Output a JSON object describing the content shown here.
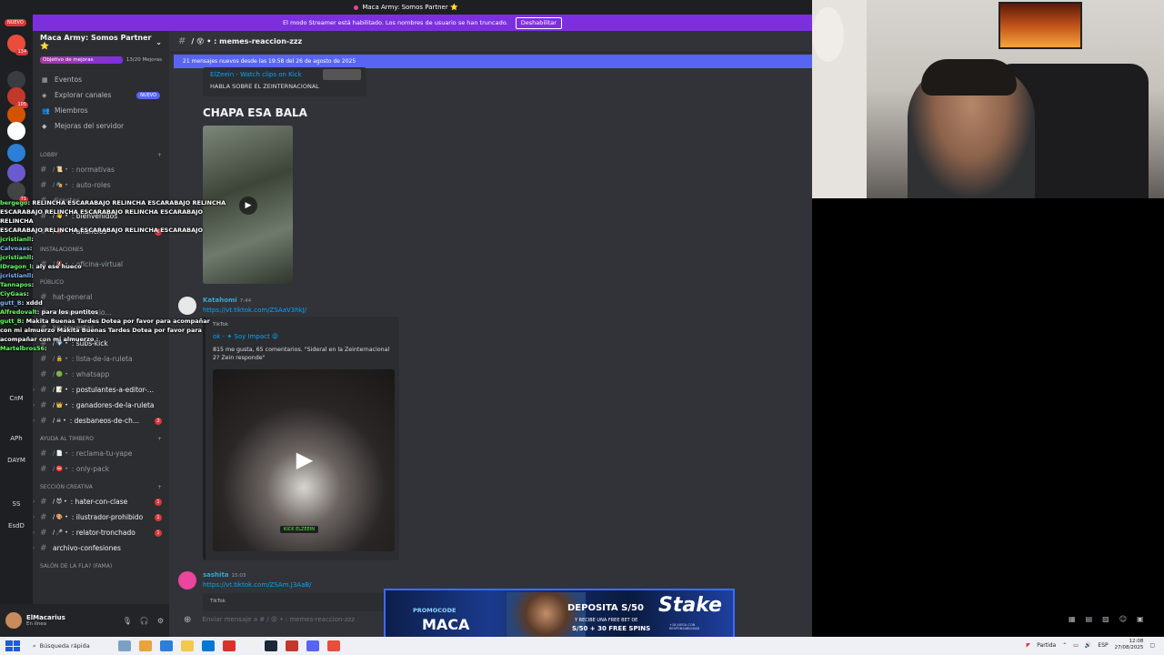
{
  "window": {
    "title": "Maca Army: Somos Partner ⭐"
  },
  "streamer_banner": {
    "text": "El modo Streamer está habilitado. Los nombres de usuario se han truncado.",
    "button": "Deshabilitar"
  },
  "rail": {
    "new_label": "NUEVO",
    "items": [
      {
        "badge": "134",
        "color": "#e84e3b"
      },
      {
        "badge": "",
        "color": "#3a3c43"
      },
      {
        "badge": "105",
        "color": "#c0392b"
      },
      {
        "badge": "",
        "color": "#d35400"
      },
      {
        "badge": "",
        "color": "#ffffff"
      },
      {
        "badge": "",
        "color": "#2d7ed6"
      },
      {
        "badge": "",
        "color": "#6a5acd"
      },
      {
        "badge": "71",
        "color": "#444444"
      }
    ],
    "texts": [
      {
        "label": "CnM",
        "badge": ""
      },
      {
        "label": "APh",
        "badge": ""
      },
      {
        "label": "DAYM",
        "badge": "8"
      },
      {
        "label": "SS",
        "badge": ""
      },
      {
        "label": "EsdD",
        "badge": ""
      }
    ]
  },
  "sidebar": {
    "server_name": "Maca Army: Somos Partner ⭐",
    "boost": {
      "label": "Objetivo de mejoras",
      "count": "13/20 Mejoras"
    },
    "nav": [
      {
        "icon": "▦",
        "label": "Eventos",
        "badge": ""
      },
      {
        "icon": "◈",
        "label": "Explorar canales",
        "badge": "NUEVO"
      },
      {
        "icon": "👥",
        "label": "Miembros",
        "badge": ""
      },
      {
        "icon": "◆",
        "label": "Mejoras del servidor",
        "badge": ""
      }
    ],
    "categories": {
      "lobby": "LOBBY",
      "instalaciones": "INSTALACIONES",
      "publico": "PÚBLICO",
      "ayuda": "AYUDA AL TIMBERO",
      "creativa": "SECCIÓN CREATIVA",
      "salon": "SALÓN DE LA FLA? (FAMA)"
    },
    "channels_lobby": [
      {
        "name": ": normativas",
        "emo": "/ 📜 •",
        "unread": false,
        "count": "",
        "chev": ""
      },
      {
        "name": ": auto-roles",
        "emo": "/ 🎭 •",
        "unread": false,
        "count": "",
        "chev": ""
      },
      {
        "name": "directos",
        "emo": "",
        "unread": false,
        "count": "",
        "chev": ""
      },
      {
        "name": ": bienvenidos",
        "emo": "/ 👋 •",
        "unread": true,
        "count": "",
        "chev": ""
      },
      {
        "name": ": anuncios",
        "emo": "/ 📣 •",
        "unread": true,
        "count": "3",
        "chev": ""
      }
    ],
    "channels_inst": [
      {
        "name": ": oficina-virtual",
        "emo": "/ 🔇 •",
        "unread": false,
        "count": "",
        "chev": ""
      }
    ],
    "channels_pub": [
      {
        "name": "hat-general",
        "emo": "",
        "unread": false,
        "count": "",
        "chev": ""
      },
      {
        "name": "memes-reaccio...",
        "emo": "",
        "unread": false,
        "count": "",
        "chev": ""
      },
      {
        "name": "ke-apuestas",
        "emo": "",
        "unread": false,
        "count": "",
        "chev": ""
      },
      {
        "name": ": subs-kick",
        "emo": "/ 💎 •",
        "unread": true,
        "count": "",
        "chev": ""
      },
      {
        "name": ": lista-de-la-ruleta",
        "emo": "/ 🔒 •",
        "unread": false,
        "count": "",
        "chev": ""
      },
      {
        "name": ": whatsapp",
        "emo": "/ 🟢 •",
        "unread": false,
        "count": "",
        "chev": ""
      },
      {
        "name": ": postulantes-a-editor-...",
        "emo": "/ 📝 •",
        "unread": true,
        "count": "",
        "chev": "›"
      },
      {
        "name": ": ganadores-de-la-ruleta",
        "emo": "/ 👑 •",
        "unread": true,
        "count": "",
        "chev": "›"
      },
      {
        "name": ": desbaneos-de-ch...",
        "emo": "/ ☠ •",
        "unread": true,
        "count": "3",
        "chev": "›"
      }
    ],
    "channels_ayuda": [
      {
        "name": ": reclama-tu-yape",
        "emo": "/ 📄 •",
        "unread": false,
        "count": "",
        "chev": ""
      },
      {
        "name": ": only-pack",
        "emo": "/ ⛔ •",
        "unread": false,
        "count": "",
        "chev": ""
      }
    ],
    "channels_creativa": [
      {
        "name": ": hater-con-clase",
        "emo": "/ 😈 •",
        "unread": true,
        "count": "1",
        "chev": "›"
      },
      {
        "name": ": ilustrador-prohibido",
        "emo": "/ 🎨 •",
        "unread": true,
        "count": "1",
        "chev": "›"
      },
      {
        "name": ": relator-tronchado",
        "emo": "/ 🎤 •",
        "unread": true,
        "count": "1",
        "chev": "›"
      },
      {
        "name": "archivo-confesiones",
        "emo": "",
        "unread": true,
        "count": "",
        "chev": "›"
      }
    ]
  },
  "user": {
    "name": "ElMacarius",
    "status": "En línea"
  },
  "chat": {
    "channel": "/ 😵 • : memes-reaccion-zzz",
    "new_messages": "21 mensajes nuevos desde las 19:58 del 26 de agosto de 2025",
    "embed_top": {
      "link": "ElZeein - Watch clips on Kick",
      "desc": "HABLA SOBRE EL ZEINTERNACIONAL"
    },
    "big_text": "CHAPA ESA BALA",
    "msg1": {
      "author": "Katahomi",
      "time": "7:44",
      "link": "https://vt.tiktok.com/ZSAaV3hkJ/",
      "provider": "TikTok",
      "title": "ok - ✦ Soy Impact 😝",
      "desc": "815 me gusta, 65 comentarios. \"Sideral en la Zeinternacional 2? Zein responde\"",
      "kick_tag": "KICK ELZEEIN"
    },
    "msg2": {
      "author": "sashita",
      "time": "15:03",
      "link": "https://vt.tiktok.com/ZSAm.J3AaB/",
      "provider": "TikTok"
    },
    "composer_placeholder": "Enviar mensaje a # / 😵 • : memes-reaccion-zzz"
  },
  "overlay_chat": [
    {
      "user": "bergego",
      "text": ": RELINCHA ESCARABAJO RELINCHA ESCARABAJO RELINCHA"
    },
    {
      "user": "",
      "text": "ESCARABAJO RELINCHA ESCARABAJO RELINCHA ESCARABAJO RELINCHA"
    },
    {
      "user": "",
      "text": "ESCARABAJO RELINCHA ESCARABAJO RELINCHA ESCARABAJO"
    },
    {
      "user": "jcristianll",
      "text": ":"
    },
    {
      "user": "Calvoaas",
      "text": ":"
    },
    {
      "user": "jcristianll",
      "text": ":"
    },
    {
      "user": "IDragon_l",
      "text": ": aly ese hueco"
    },
    {
      "user": "jcristianll",
      "text": ":"
    },
    {
      "user": "Tannapos",
      "text": ":"
    },
    {
      "user": "CiyGaas",
      "text": ":"
    },
    {
      "user": "gutt_B",
      "text": ": xddd"
    },
    {
      "user": "Alfredovalt",
      "text": ": para los puntitos"
    },
    {
      "user": "gutt_B",
      "text": ": Makita Buenas Tardes Dotea por favor para acompañar"
    },
    {
      "user": "",
      "text": "con mi almuerzo Makita Buenas Tardes Dotea por favor para"
    },
    {
      "user": "",
      "text": "acompañar con mi almuerzo :"
    },
    {
      "user": "Martelbros56",
      "text": ":"
    }
  ],
  "ad": {
    "promo": "PROMOCODE",
    "code": "MACA",
    "deposit": "DEPOSITA S/50",
    "sub1": "Y RECIBE UNA FREE BET DE",
    "sub2": "S/50 + 30 FREE SPINS",
    "brand": "Stake",
    "fine": "+18 JUEGA CON RESPONSABILIDAD"
  },
  "taskbar": {
    "search": "Búsqueda rápida",
    "weather": "Partida",
    "lang": "ESP",
    "time": "12:08",
    "date": "27/08/2025"
  }
}
